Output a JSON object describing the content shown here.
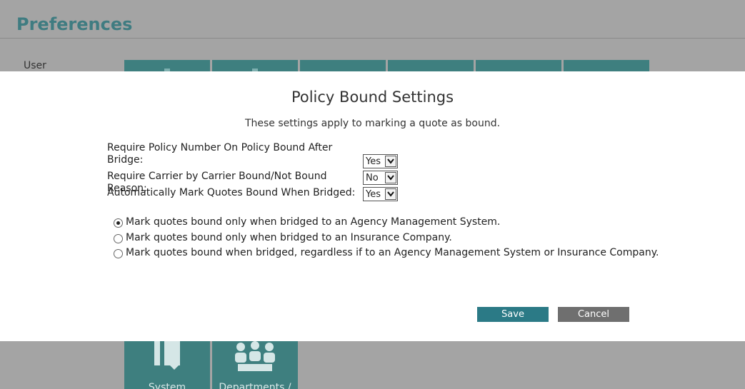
{
  "background": {
    "title": "Preferences",
    "user_label": "User",
    "bottom_tiles": [
      "System",
      "Departments /"
    ]
  },
  "modal": {
    "title": "Policy Bound Settings",
    "subtitle": "These settings apply to marking a quote as bound.",
    "settings": [
      {
        "label": "Require Policy Number On Policy Bound After Bridge:",
        "value": "Yes"
      },
      {
        "label": "Require Carrier by Carrier Bound/Not Bound Reason:",
        "value": "No"
      },
      {
        "label": "Automatically Mark Quotes Bound When Bridged:",
        "value": "Yes"
      }
    ],
    "options": [
      {
        "label": "Mark quotes bound only when bridged to an Agency Management System.",
        "selected": true
      },
      {
        "label": "Mark quotes bound only when bridged to an Insurance Company.",
        "selected": false
      },
      {
        "label": "Mark quotes bound when bridged, regardless if to an Agency Management System or Insurance Company.",
        "selected": false
      }
    ],
    "save_label": "Save",
    "cancel_label": "Cancel"
  },
  "colors": {
    "accent": "#2b7a86",
    "tile": "#3e7f7f",
    "overlay": "#a4a4a4"
  }
}
